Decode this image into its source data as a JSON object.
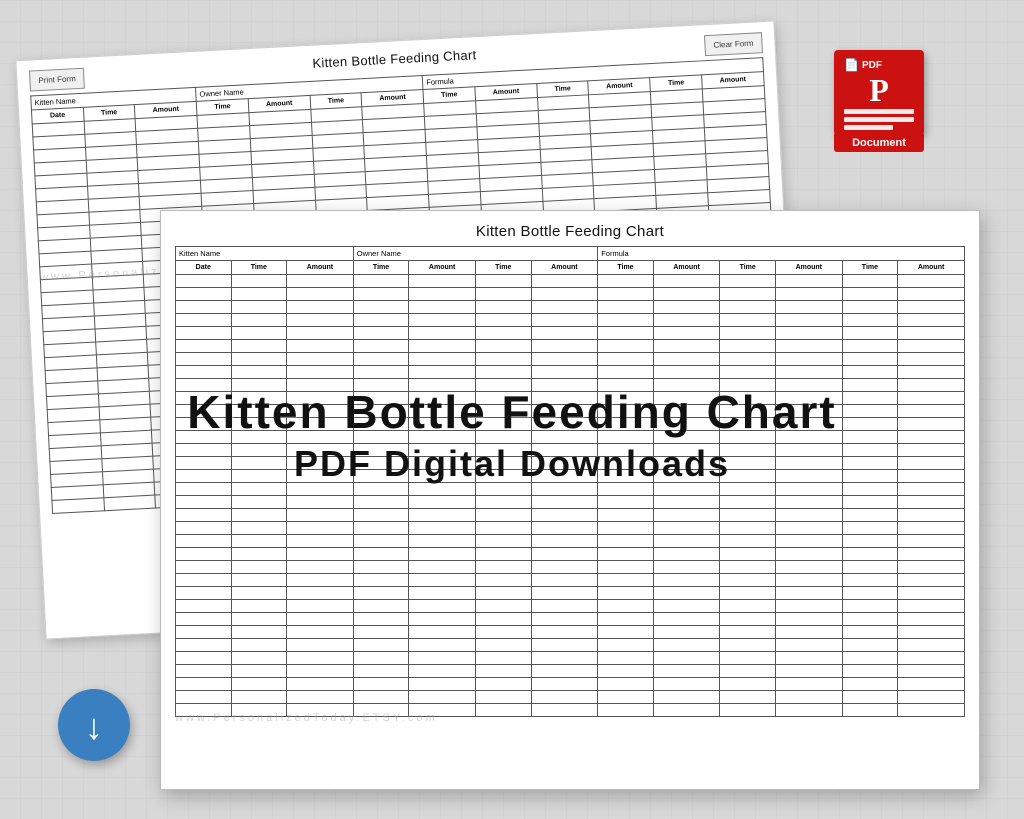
{
  "back_doc": {
    "title": "Kitten Bottle Feeding Chart",
    "btn_print": "Print Form",
    "btn_clear": "Clear Form",
    "headers": {
      "kitten_name": "Kitten Name",
      "owner_name": "Owner Name",
      "formula": "Formula"
    },
    "col_headers": [
      "Date",
      "Time",
      "Amount",
      "Time",
      "Amount",
      "Time",
      "Amount",
      "Time",
      "Amount",
      "Time",
      "Amount",
      "Time",
      "Amount"
    ]
  },
  "front_doc": {
    "title": "Kitten Bottle Feeding Chart",
    "headers": {
      "kitten_name": "Kitten Name",
      "owner_name": "Owner Name",
      "formula": "Formula"
    },
    "col_headers": [
      "Date",
      "Time",
      "Amount",
      "Time",
      "Amount",
      "Time",
      "Amount",
      "Time",
      "Amount",
      "Time",
      "Amount",
      "Time",
      "Amount"
    ]
  },
  "overlay": {
    "line1": "Kitten Bottle Feeding Chart",
    "line2": "PDF Digital Downloads"
  },
  "pdf_icon": {
    "label_top": "PDF",
    "letter": "P",
    "label_bottom": "Document"
  },
  "watermark": {
    "text": "www.PersonalizedToday.ETSY.com"
  },
  "download_btn": {
    "label": "↓"
  }
}
